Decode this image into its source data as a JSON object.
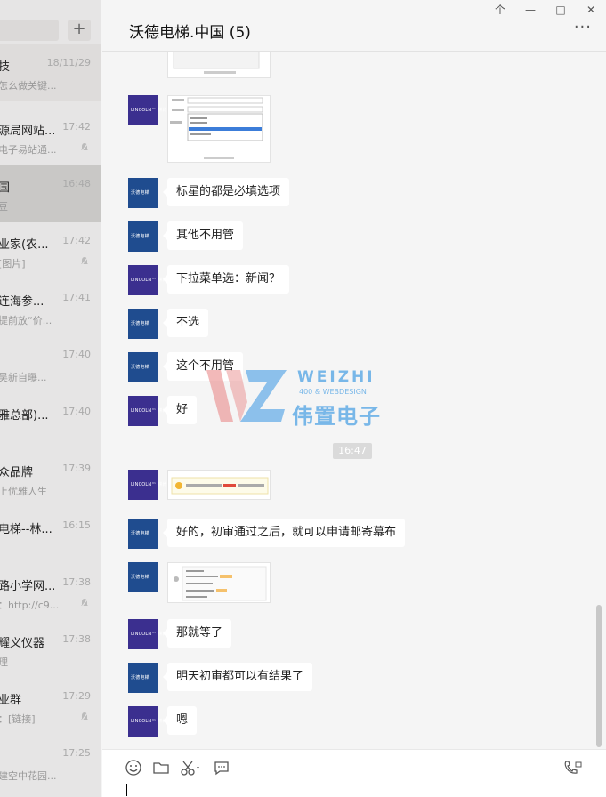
{
  "window": {
    "pin_label": "个",
    "minimize_label": "—",
    "maximize_label": "□",
    "close_label": "✕"
  },
  "sidebar": {
    "add_label": "+",
    "conversations": [
      {
        "name": "技",
        "time": "18/11/29",
        "preview": "怎么做关键...",
        "muted": false,
        "state": "hover"
      },
      {
        "name": "源局网站...",
        "time": "17:42",
        "preview": "电子易站通...",
        "muted": true,
        "state": ""
      },
      {
        "name": "国",
        "time": "16:48",
        "preview": "豆",
        "muted": false,
        "state": "active"
      },
      {
        "name": "业家(农...",
        "time": "17:42",
        "preview": "[图片]",
        "muted": true,
        "state": ""
      },
      {
        "name": "连海参...",
        "time": "17:41",
        "preview": "提前放“价...",
        "muted": false,
        "state": ""
      },
      {
        "name": "",
        "time": "17:40",
        "preview": "吴新自曝...",
        "muted": false,
        "state": ""
      },
      {
        "name": "雅总部)...",
        "time": "17:40",
        "preview": "",
        "muted": false,
        "state": ""
      },
      {
        "name": "众品牌",
        "time": "17:39",
        "preview": "上优雅人生",
        "muted": false,
        "state": ""
      },
      {
        "name": "电梯--林...",
        "time": "16:15",
        "preview": "",
        "muted": false,
        "state": ""
      },
      {
        "name": "路小学网...",
        "time": "17:38",
        "preview": "：http://c9...",
        "muted": true,
        "state": ""
      },
      {
        "name": "耀义仪器",
        "time": "17:38",
        "preview": "理",
        "muted": false,
        "state": ""
      },
      {
        "name": "业群",
        "time": "17:29",
        "preview": "：[链接]",
        "muted": true,
        "state": ""
      },
      {
        "name": "",
        "time": "17:25",
        "preview": "建空中花园...",
        "muted": false,
        "state": ""
      }
    ]
  },
  "chat": {
    "title": "沃德电梯.中国 (5)",
    "more_label": "···",
    "avatar_purple_text": "LINCOLN™ 林肯电梯",
    "avatar_blue_text": "沃德电梯",
    "time_divider": "16:47",
    "messages": {
      "m1": "标星的都是必填选项",
      "m2": "其他不用管",
      "m3": "下拉菜单选：新闻？",
      "m4": "不选",
      "m5": "这个不用管",
      "m6": "好",
      "m7": "好的，初审通过之后，就可以申请邮寄幕布",
      "m8": "那就等了",
      "m9": "明天初审都可以有结果了",
      "m10": "嗯"
    }
  },
  "watermark": {
    "en": "WEIZHI",
    "sub": "400 & WEBDESIGN",
    "cn": "伟置电子"
  },
  "colors": {
    "purple_avatar": "#3b2f8f",
    "blue_avatar": "#1f4c8f",
    "watermark": "#5aa8e6"
  }
}
